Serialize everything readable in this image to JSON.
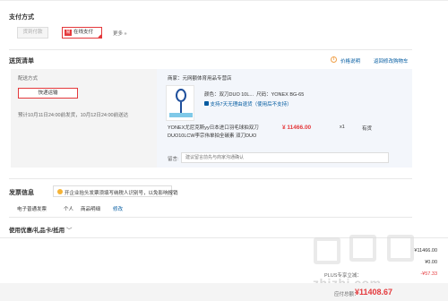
{
  "payment": {
    "title": "支付方式",
    "options": [
      {
        "label": "货到付款",
        "state": "disabled"
      },
      {
        "label": "在线支付",
        "state": "selected",
        "icon_char": "易"
      }
    ],
    "more": "更多 »"
  },
  "delivery": {
    "title": "送货清单",
    "price_note": "价格说明",
    "back_to_cart": "返回修改购物车",
    "method_label": "配送方式",
    "method_button": "快递运输",
    "schedule": "预计10月11日24:00前发货，10月12日24:00前送达"
  },
  "product": {
    "merchant": "商家：元网额体育用品专营店",
    "color": "颜色：双刀DUO 10L...",
    "size": "尺码：YONEX BG-65",
    "support": "支持7天无理由退货（使用后不支持）",
    "name": "YONEX尤尼克斯yy日本进口羽毛球拍双刀DUO10LCW李宗伟单拍全碳素 双刀DUO",
    "price": "¥ 11466.00",
    "quantity": "x1",
    "stock": "有货",
    "remark_label": "留言:",
    "remark_placeholder": "建议留言前先与商家沟通确认"
  },
  "invoice": {
    "title": "发票信息",
    "tip": "开企业抬头发票须填写纳税人识别号，以免影响报销",
    "type": "电子普通发票",
    "holder": "个人",
    "content": "商品明细",
    "modify": "修改"
  },
  "discount": {
    "title": "使用优惠/礼品卡/抵用",
    "chevron": "﹀"
  },
  "totals": {
    "rows": [
      {
        "label": "",
        "value": "¥11466.00",
        "red": false
      },
      {
        "label": "",
        "value": "¥0.00",
        "red": false
      },
      {
        "label": "PLUS专享立减：",
        "value": "-¥57.33",
        "red": true
      }
    ],
    "pay_label": "应付总额：",
    "pay_amount": "¥11408.67"
  },
  "watermark": {
    "text": "zhizhi.com"
  },
  "colors": {
    "accent": "#e4393c",
    "link": "#005aa0",
    "panel": "#f4f4f4",
    "product_panel": "#f3f6fb"
  }
}
